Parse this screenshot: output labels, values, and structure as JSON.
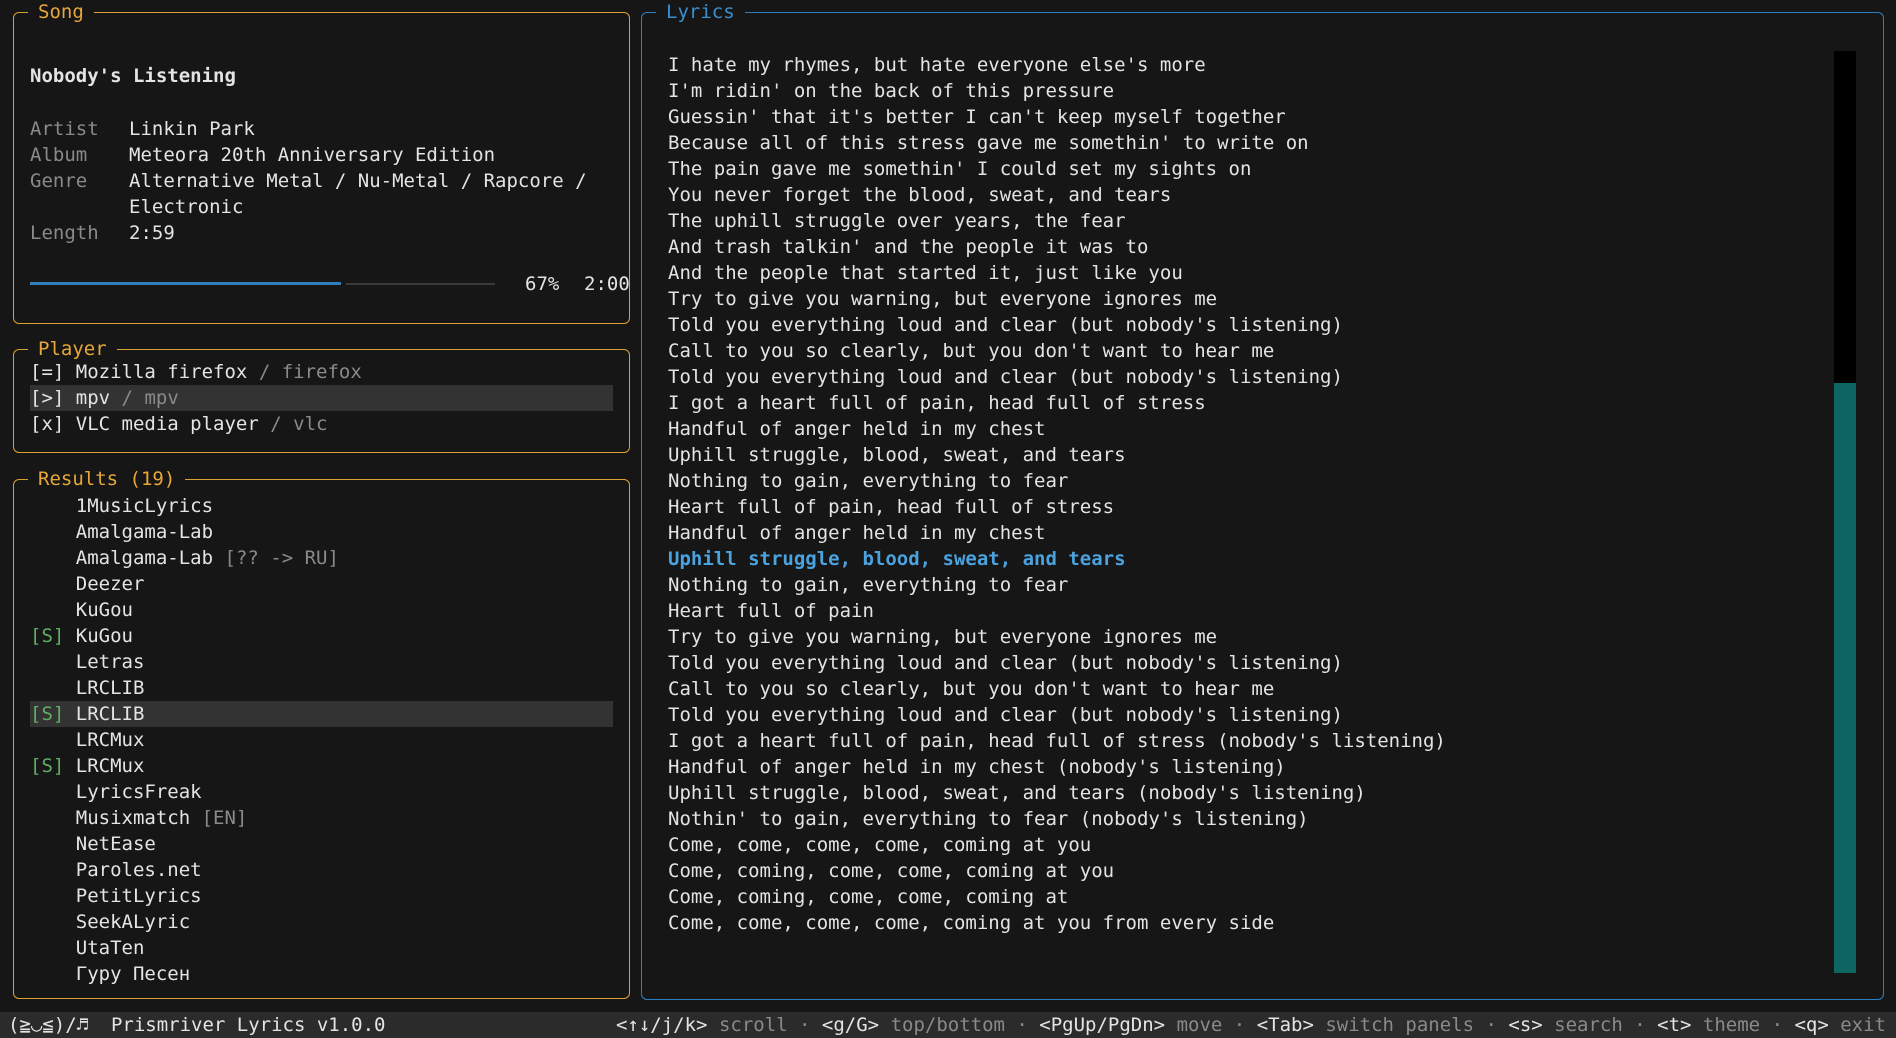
{
  "song": {
    "panel_title": "Song",
    "title": "Nobody's Listening",
    "artist_label": "Artist",
    "artist": "Linkin Park",
    "album_label": "Album",
    "album": "Meteora 20th Anniversary Edition",
    "genre_label": "Genre",
    "genre": "Alternative Metal / Nu-Metal / Rapcore / Electronic",
    "length_label": "Length",
    "length": "2:59",
    "progress_fraction": 0.67,
    "progress_text": "67%",
    "elapsed": "2:00",
    "accent": "#2e7fbf"
  },
  "player": {
    "panel_title": "Player",
    "items": [
      {
        "state": "[=]",
        "name": "Mozilla firefox",
        "sep": " / ",
        "id": "firefox",
        "selected": false
      },
      {
        "state": "[>]",
        "name": "mpv",
        "sep": " / ",
        "id": "mpv",
        "selected": true
      },
      {
        "state": "[x]",
        "name": "VLC media player",
        "sep": " / ",
        "id": "vlc",
        "selected": false
      }
    ]
  },
  "results": {
    "panel_title": "Results (19)",
    "items": [
      {
        "tag": "   ",
        "name": "1MusicLyrics",
        "note": ""
      },
      {
        "tag": "   ",
        "name": "Amalgama-Lab",
        "note": ""
      },
      {
        "tag": "   ",
        "name": "Amalgama-Lab",
        "note": " [?? -> RU]"
      },
      {
        "tag": "   ",
        "name": "Deezer",
        "note": ""
      },
      {
        "tag": "   ",
        "name": "KuGou",
        "note": ""
      },
      {
        "tag": "[S]",
        "name": "KuGou",
        "note": ""
      },
      {
        "tag": "   ",
        "name": "Letras",
        "note": ""
      },
      {
        "tag": "   ",
        "name": "LRCLIB",
        "note": ""
      },
      {
        "tag": "[S]",
        "name": "LRCLIB",
        "note": "",
        "selected": true
      },
      {
        "tag": "   ",
        "name": "LRCMux",
        "note": ""
      },
      {
        "tag": "[S]",
        "name": "LRCMux",
        "note": ""
      },
      {
        "tag": "   ",
        "name": "LyricsFreak",
        "note": ""
      },
      {
        "tag": "   ",
        "name": "Musixmatch",
        "note": " [EN]"
      },
      {
        "tag": "   ",
        "name": "NetEase",
        "note": ""
      },
      {
        "tag": "   ",
        "name": "Paroles.net",
        "note": ""
      },
      {
        "tag": "   ",
        "name": "PetitLyrics",
        "note": ""
      },
      {
        "tag": "   ",
        "name": "SeekALyric",
        "note": ""
      },
      {
        "tag": "   ",
        "name": "UtaTen",
        "note": ""
      },
      {
        "tag": "   ",
        "name": "Гуру Песен",
        "note": ""
      }
    ]
  },
  "lyrics": {
    "panel_title": "Lyrics",
    "current_index": 19,
    "scroll_position_fraction": 0.36,
    "lines": [
      "I hate my rhymes, but hate everyone else's more",
      "I'm ridin' on the back of this pressure",
      "Guessin' that it's better I can't keep myself together",
      "Because all of this stress gave me somethin' to write on",
      "The pain gave me somethin' I could set my sights on",
      "You never forget the blood, sweat, and tears",
      "The uphill struggle over years, the fear",
      "And trash talkin' and the people it was to",
      "And the people that started it, just like you",
      "Try to give you warning, but everyone ignores me",
      "Told you everything loud and clear (but nobody's listening)",
      "Call to you so clearly, but you don't want to hear me",
      "Told you everything loud and clear (but nobody's listening)",
      "I got a heart full of pain, head full of stress",
      "Handful of anger held in my chest",
      "Uphill struggle, blood, sweat, and tears",
      "Nothing to gain, everything to fear",
      "Heart full of pain, head full of stress",
      "Handful of anger held in my chest",
      "Uphill struggle, blood, sweat, and tears",
      "Nothing to gain, everything to fear",
      "Heart full of pain",
      "Try to give you warning, but everyone ignores me",
      "Told you everything loud and clear (but nobody's listening)",
      "Call to you so clearly, but you don't want to hear me",
      "Told you everything loud and clear (but nobody's listening)",
      "I got a heart full of pain, head full of stress (nobody's listening)",
      "Handful of anger held in my chest (nobody's listening)",
      "Uphill struggle, blood, sweat, and tears (nobody's listening)",
      "Nothin' to gain, everything to fear (nobody's listening)",
      "Come, come, come, come, coming at you",
      "Come, coming, come, come, coming at you",
      "Come, coming, come, come, coming at",
      "Come, come, come, come, coming at you from every side"
    ]
  },
  "status": {
    "app_name": "(≧◡≦)/♬  Prismriver Lyrics v1.0.0",
    "hints": [
      {
        "key": "<↑↓/j/k>",
        "desc": "scroll"
      },
      {
        "key": "<g/G>",
        "desc": "top/bottom"
      },
      {
        "key": "<PgUp/PgDn>",
        "desc": "move"
      },
      {
        "key": "<Tab>",
        "desc": "switch panels"
      },
      {
        "key": "<s>",
        "desc": "search"
      },
      {
        "key": "<t>",
        "desc": "theme"
      },
      {
        "key": "<q>",
        "desc": "exit"
      }
    ],
    "separator": " · "
  }
}
